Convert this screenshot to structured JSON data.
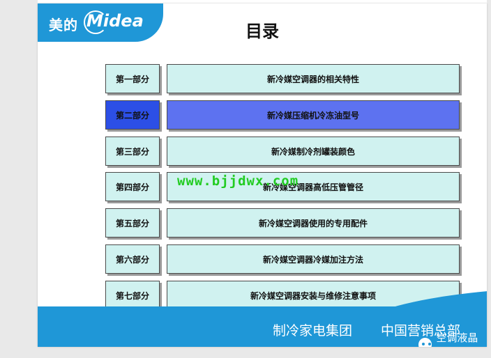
{
  "logo": {
    "chinese": "美的",
    "english": "Midea"
  },
  "title": "目录",
  "sections": [
    {
      "part": "第一部分",
      "label": "新冷媒空调器的相关特性"
    },
    {
      "part": "第二部分",
      "label": "新冷媒压缩机冷冻油型号",
      "active": true
    },
    {
      "part": "第三部分",
      "label": "新冷媒制冷剂罐装颜色"
    },
    {
      "part": "第四部分",
      "label": "新冷媒空调器高低压管管径"
    },
    {
      "part": "第五部分",
      "label": "新冷媒空调器使用的专用配件"
    },
    {
      "part": "第六部分",
      "label": "新冷媒空调器冷媒加注方法"
    },
    {
      "part": "第七部分",
      "label": "新冷媒空调器安装与维修注意事项"
    }
  ],
  "footer": {
    "left_text": "制冷家电集团",
    "right_text": "中国营销总部"
  },
  "watermark": "www.bjjdwx.com",
  "wechat_badge": {
    "icon": "wechat-icon",
    "text": "空调液晶维修"
  },
  "colors": {
    "brand_blue": "#1f97d7",
    "box_fill": "#d0f2f0",
    "active_part": "#2c4fe6",
    "active_label": "#5d72f0",
    "watermark": "#22cc22"
  }
}
